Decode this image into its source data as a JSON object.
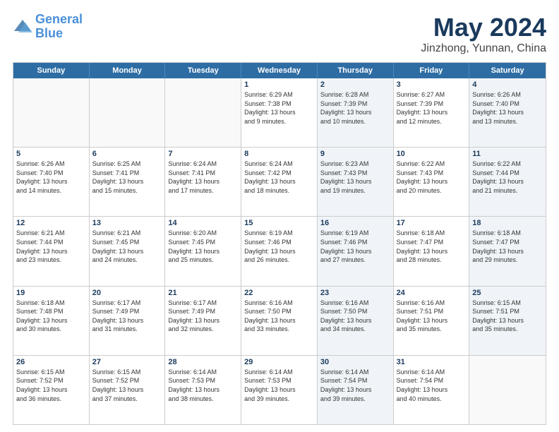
{
  "header": {
    "logo_line1": "General",
    "logo_line2": "Blue",
    "title": "May 2024",
    "subtitle": "Jinzhong, Yunnan, China"
  },
  "days_of_week": [
    "Sunday",
    "Monday",
    "Tuesday",
    "Wednesday",
    "Thursday",
    "Friday",
    "Saturday"
  ],
  "weeks": [
    [
      {
        "day": "",
        "info": "",
        "shaded": false,
        "empty": true
      },
      {
        "day": "",
        "info": "",
        "shaded": false,
        "empty": true
      },
      {
        "day": "",
        "info": "",
        "shaded": false,
        "empty": true
      },
      {
        "day": "1",
        "info": "Sunrise: 6:29 AM\nSunset: 7:38 PM\nDaylight: 13 hours\nand 9 minutes.",
        "shaded": false,
        "empty": false
      },
      {
        "day": "2",
        "info": "Sunrise: 6:28 AM\nSunset: 7:39 PM\nDaylight: 13 hours\nand 10 minutes.",
        "shaded": true,
        "empty": false
      },
      {
        "day": "3",
        "info": "Sunrise: 6:27 AM\nSunset: 7:39 PM\nDaylight: 13 hours\nand 12 minutes.",
        "shaded": false,
        "empty": false
      },
      {
        "day": "4",
        "info": "Sunrise: 6:26 AM\nSunset: 7:40 PM\nDaylight: 13 hours\nand 13 minutes.",
        "shaded": true,
        "empty": false
      }
    ],
    [
      {
        "day": "5",
        "info": "Sunrise: 6:26 AM\nSunset: 7:40 PM\nDaylight: 13 hours\nand 14 minutes.",
        "shaded": false,
        "empty": false
      },
      {
        "day": "6",
        "info": "Sunrise: 6:25 AM\nSunset: 7:41 PM\nDaylight: 13 hours\nand 15 minutes.",
        "shaded": false,
        "empty": false
      },
      {
        "day": "7",
        "info": "Sunrise: 6:24 AM\nSunset: 7:41 PM\nDaylight: 13 hours\nand 17 minutes.",
        "shaded": false,
        "empty": false
      },
      {
        "day": "8",
        "info": "Sunrise: 6:24 AM\nSunset: 7:42 PM\nDaylight: 13 hours\nand 18 minutes.",
        "shaded": false,
        "empty": false
      },
      {
        "day": "9",
        "info": "Sunrise: 6:23 AM\nSunset: 7:43 PM\nDaylight: 13 hours\nand 19 minutes.",
        "shaded": true,
        "empty": false
      },
      {
        "day": "10",
        "info": "Sunrise: 6:22 AM\nSunset: 7:43 PM\nDaylight: 13 hours\nand 20 minutes.",
        "shaded": false,
        "empty": false
      },
      {
        "day": "11",
        "info": "Sunrise: 6:22 AM\nSunset: 7:44 PM\nDaylight: 13 hours\nand 21 minutes.",
        "shaded": true,
        "empty": false
      }
    ],
    [
      {
        "day": "12",
        "info": "Sunrise: 6:21 AM\nSunset: 7:44 PM\nDaylight: 13 hours\nand 23 minutes.",
        "shaded": false,
        "empty": false
      },
      {
        "day": "13",
        "info": "Sunrise: 6:21 AM\nSunset: 7:45 PM\nDaylight: 13 hours\nand 24 minutes.",
        "shaded": false,
        "empty": false
      },
      {
        "day": "14",
        "info": "Sunrise: 6:20 AM\nSunset: 7:45 PM\nDaylight: 13 hours\nand 25 minutes.",
        "shaded": false,
        "empty": false
      },
      {
        "day": "15",
        "info": "Sunrise: 6:19 AM\nSunset: 7:46 PM\nDaylight: 13 hours\nand 26 minutes.",
        "shaded": false,
        "empty": false
      },
      {
        "day": "16",
        "info": "Sunrise: 6:19 AM\nSunset: 7:46 PM\nDaylight: 13 hours\nand 27 minutes.",
        "shaded": true,
        "empty": false
      },
      {
        "day": "17",
        "info": "Sunrise: 6:18 AM\nSunset: 7:47 PM\nDaylight: 13 hours\nand 28 minutes.",
        "shaded": false,
        "empty": false
      },
      {
        "day": "18",
        "info": "Sunrise: 6:18 AM\nSunset: 7:47 PM\nDaylight: 13 hours\nand 29 minutes.",
        "shaded": true,
        "empty": false
      }
    ],
    [
      {
        "day": "19",
        "info": "Sunrise: 6:18 AM\nSunset: 7:48 PM\nDaylight: 13 hours\nand 30 minutes.",
        "shaded": false,
        "empty": false
      },
      {
        "day": "20",
        "info": "Sunrise: 6:17 AM\nSunset: 7:49 PM\nDaylight: 13 hours\nand 31 minutes.",
        "shaded": false,
        "empty": false
      },
      {
        "day": "21",
        "info": "Sunrise: 6:17 AM\nSunset: 7:49 PM\nDaylight: 13 hours\nand 32 minutes.",
        "shaded": false,
        "empty": false
      },
      {
        "day": "22",
        "info": "Sunrise: 6:16 AM\nSunset: 7:50 PM\nDaylight: 13 hours\nand 33 minutes.",
        "shaded": false,
        "empty": false
      },
      {
        "day": "23",
        "info": "Sunrise: 6:16 AM\nSunset: 7:50 PM\nDaylight: 13 hours\nand 34 minutes.",
        "shaded": true,
        "empty": false
      },
      {
        "day": "24",
        "info": "Sunrise: 6:16 AM\nSunset: 7:51 PM\nDaylight: 13 hours\nand 35 minutes.",
        "shaded": false,
        "empty": false
      },
      {
        "day": "25",
        "info": "Sunrise: 6:15 AM\nSunset: 7:51 PM\nDaylight: 13 hours\nand 35 minutes.",
        "shaded": true,
        "empty": false
      }
    ],
    [
      {
        "day": "26",
        "info": "Sunrise: 6:15 AM\nSunset: 7:52 PM\nDaylight: 13 hours\nand 36 minutes.",
        "shaded": false,
        "empty": false
      },
      {
        "day": "27",
        "info": "Sunrise: 6:15 AM\nSunset: 7:52 PM\nDaylight: 13 hours\nand 37 minutes.",
        "shaded": false,
        "empty": false
      },
      {
        "day": "28",
        "info": "Sunrise: 6:14 AM\nSunset: 7:53 PM\nDaylight: 13 hours\nand 38 minutes.",
        "shaded": false,
        "empty": false
      },
      {
        "day": "29",
        "info": "Sunrise: 6:14 AM\nSunset: 7:53 PM\nDaylight: 13 hours\nand 39 minutes.",
        "shaded": false,
        "empty": false
      },
      {
        "day": "30",
        "info": "Sunrise: 6:14 AM\nSunset: 7:54 PM\nDaylight: 13 hours\nand 39 minutes.",
        "shaded": true,
        "empty": false
      },
      {
        "day": "31",
        "info": "Sunrise: 6:14 AM\nSunset: 7:54 PM\nDaylight: 13 hours\nand 40 minutes.",
        "shaded": false,
        "empty": false
      },
      {
        "day": "",
        "info": "",
        "shaded": true,
        "empty": true
      }
    ]
  ]
}
